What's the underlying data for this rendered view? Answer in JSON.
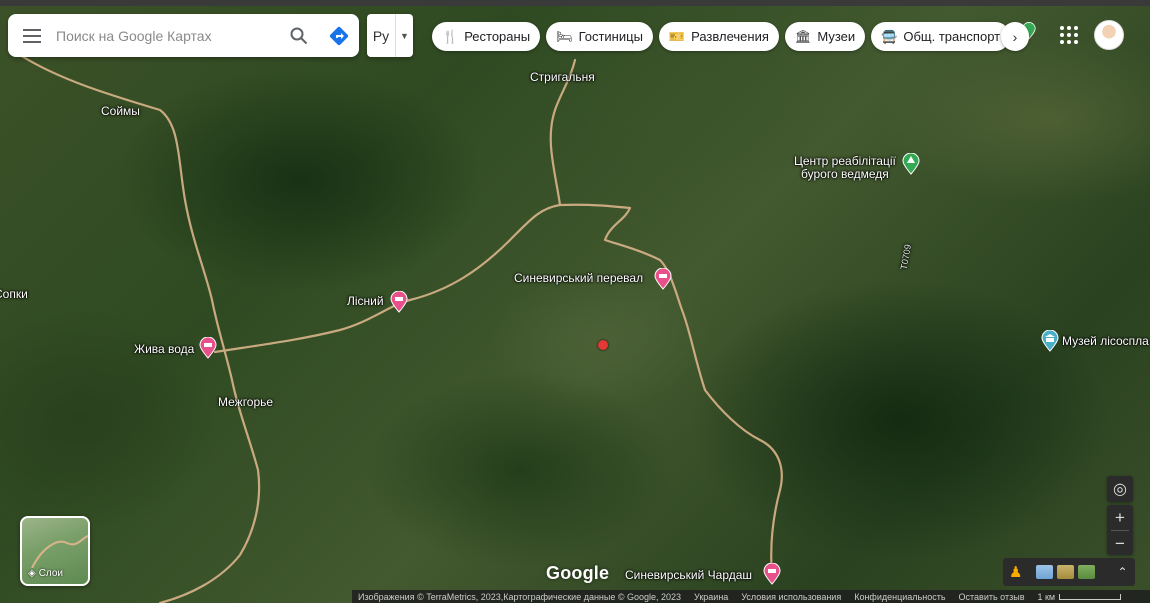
{
  "search": {
    "placeholder": "Поиск на Google Картах"
  },
  "language": {
    "code": "Ру"
  },
  "chips": [
    {
      "label": "Рестораны",
      "icon": "fork-knife-icon"
    },
    {
      "label": "Гостиницы",
      "icon": "bed-icon"
    },
    {
      "label": "Развлечения",
      "icon": "ticket-icon"
    },
    {
      "label": "Музеи",
      "icon": "museum-icon"
    },
    {
      "label": "Общ. транспорт",
      "icon": "bus-icon"
    }
  ],
  "places": {
    "soimy": "Соймы",
    "strygalnya": "Стригальня",
    "centre": "Центр реабілітації бурого ведмедя",
    "centre_line1": "Центр реабілітації",
    "centre_line2": "бурого ведмедя",
    "lisnyi": "Лісний",
    "synevyrskyi_pass": "Синевирський перевал",
    "zhyva_voda": "Жива вода",
    "mezhgorye": "Межгорье",
    "sopky": "Сопки",
    "museum": "Музей лісоспла",
    "chardash": "Синевирський Чардаш",
    "road": "Т0709"
  },
  "layers": {
    "label": "Слои"
  },
  "logo": "Google",
  "footer": {
    "imagery": "Изображения © TerraMetrics, 2023,Картографические данные © Google, 2023",
    "country": "Украина",
    "terms": "Условия использования",
    "privacy": "Конфиденциальность",
    "feedback": "Оставить отзыв",
    "scale": "1 км"
  },
  "colors": {
    "hotel_pin": "#e8508a",
    "park_pin": "#34a853",
    "museum_pin": "#4ab0c8",
    "road": "#d9b48a"
  }
}
